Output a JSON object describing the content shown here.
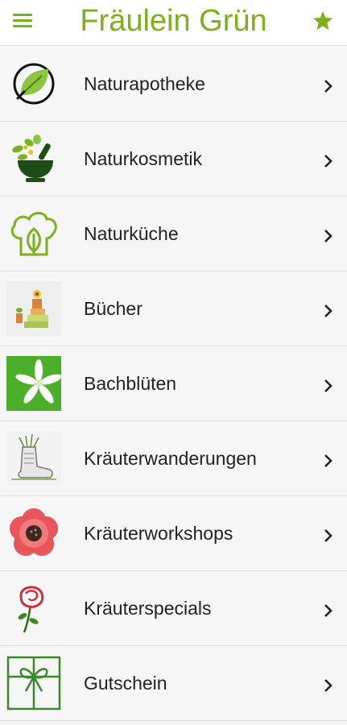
{
  "header": {
    "title": "Fräulein Grün",
    "accent_color": "#7cb11e",
    "menu_icon": "hamburger-menu-icon",
    "favorite_icon": "star-icon"
  },
  "menu": {
    "items": [
      {
        "label": "Naturapotheke",
        "icon": "leaf-circle-icon"
      },
      {
        "label": "Naturkosmetik",
        "icon": "mortar-pestle-icon"
      },
      {
        "label": "Naturküche",
        "icon": "chef-hat-leaf-icon"
      },
      {
        "label": "Bücher",
        "icon": "books-plant-icon"
      },
      {
        "label": "Bachblüten",
        "icon": "white-flower-icon"
      },
      {
        "label": "Kräuterwanderungen",
        "icon": "hiking-boot-icon"
      },
      {
        "label": "Kräuterworkshops",
        "icon": "red-flower-icon"
      },
      {
        "label": "Kräuterspecials",
        "icon": "rose-icon"
      },
      {
        "label": "Gutschein",
        "icon": "gift-box-icon"
      }
    ],
    "chevron_icon": "chevron-right-icon"
  }
}
